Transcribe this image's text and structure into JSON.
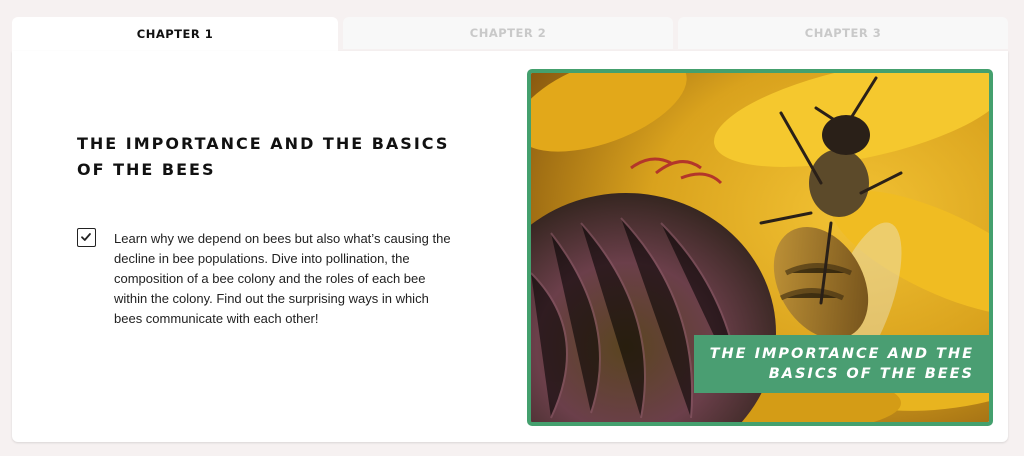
{
  "tabs": [
    {
      "label": "CHAPTER 1",
      "active": true
    },
    {
      "label": "CHAPTER 2",
      "active": false
    },
    {
      "label": "CHAPTER 3",
      "active": false
    }
  ],
  "content": {
    "heading_line1": "THE IMPORTANCE AND THE BASICS",
    "heading_line2": "OF THE BEES",
    "checkbox_checked": true,
    "description": "Learn why we depend on bees but also what’s causing the decline in bee populations. Dive into pollination, the composition of a bee colony and the roles of each bee within the colony. Find out the surprising ways in which bees communicate with each other!"
  },
  "figure": {
    "image_subject": "honeybee on sunflower",
    "caption_line1": "THE IMPORTANCE AND THE",
    "caption_line2": "BASICS OF THE BEES"
  },
  "colors": {
    "accent_green": "#44a06e",
    "caption_green": "#4a9e72",
    "page_bg": "#f6f1f1"
  }
}
